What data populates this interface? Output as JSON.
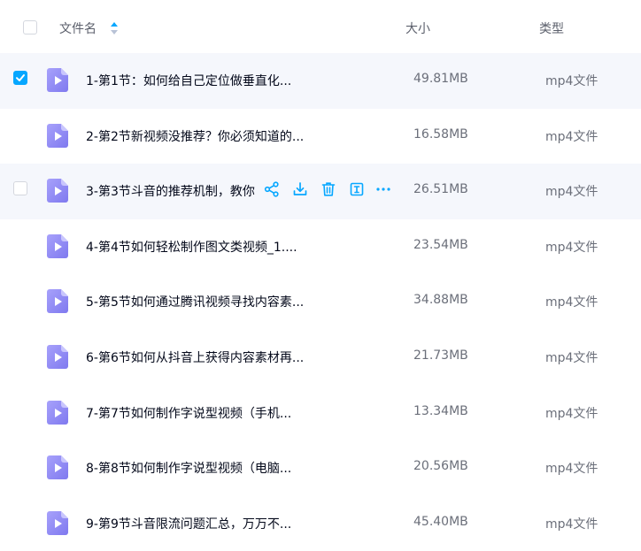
{
  "header": {
    "name_label": "文件名",
    "size_label": "大小",
    "type_label": "类型"
  },
  "colors": {
    "accent": "#06a7ff",
    "file_icon": "#8a84f5",
    "row_highlight": "#f5f7fc"
  },
  "files": [
    {
      "name": "1-第1节：如何给自己定位做垂直化...",
      "size": "49.81MB",
      "type": "mp4文件",
      "checked": true
    },
    {
      "name": "2-第2节新视频没推荐？你必须知道的...",
      "size": "16.58MB",
      "type": "mp4文件",
      "checked": false
    },
    {
      "name": "3-第3节斗音的推荐机制，教你",
      "size": "26.51MB",
      "type": "mp4文件",
      "checked": false,
      "hovered": true
    },
    {
      "name": "4-第4节如何轻松制作图文类视频_1....",
      "size": "23.54MB",
      "type": "mp4文件",
      "checked": false
    },
    {
      "name": "5-第5节如何通过腾讯视频寻找内容素...",
      "size": "34.88MB",
      "type": "mp4文件",
      "checked": false
    },
    {
      "name": "6-第6节如何从抖音上获得内容素材再...",
      "size": "21.73MB",
      "type": "mp4文件",
      "checked": false
    },
    {
      "name": "7-第7节如何制作字说型视频（手机...",
      "size": "13.34MB",
      "type": "mp4文件",
      "checked": false
    },
    {
      "name": "8-第8节如何制作字说型视频（电脑...",
      "size": "20.56MB",
      "type": "mp4文件",
      "checked": false
    },
    {
      "name": "9-第9节斗音限流问题汇总，万万不...",
      "size": "45.40MB",
      "type": "mp4文件",
      "checked": false
    }
  ],
  "row_actions": [
    "share-icon",
    "download-icon",
    "delete-icon",
    "rename-icon",
    "more-icon"
  ]
}
